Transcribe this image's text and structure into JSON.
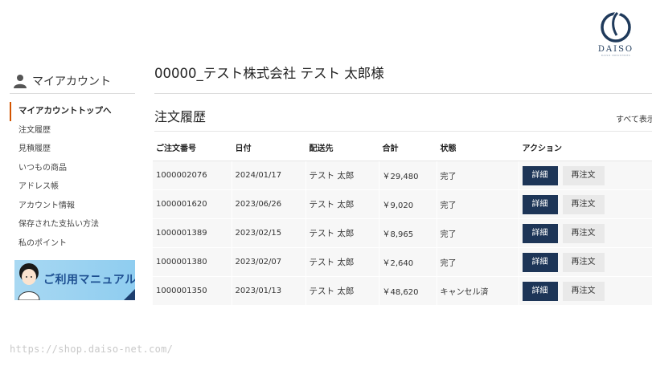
{
  "brand": {
    "name": "DAISO",
    "tagline": "DAISO INDUSTRIES",
    "color": "#1f3a5b"
  },
  "sidebar": {
    "title": "マイアカウント",
    "items": [
      {
        "label": "マイアカウントトップへ",
        "active": true
      },
      {
        "label": "注文履歴"
      },
      {
        "label": "見積履歴"
      },
      {
        "label": "いつもの商品"
      },
      {
        "label": "アドレス帳"
      },
      {
        "label": "アカウント情報"
      },
      {
        "label": "保存された支払い方法"
      },
      {
        "label": "私のポイント"
      }
    ],
    "banner_label": "ご利用マニュアル"
  },
  "main": {
    "title": "00000_テスト株式会社 テスト 太郎様",
    "section_title": "注文履歴",
    "view_all": "すべて表示"
  },
  "table": {
    "headers": [
      "ご注文番号",
      "日付",
      "配送先",
      "合計",
      "状態",
      "アクション"
    ],
    "rows": [
      {
        "order_no": "1000002076",
        "date": "2024/01/17",
        "ship_to": "テスト 太郎",
        "total": "￥29,480",
        "status": "完了",
        "detail": "詳細",
        "reorder": "再注文"
      },
      {
        "order_no": "1000001620",
        "date": "2023/06/26",
        "ship_to": "テスト 太郎",
        "total": "￥9,020",
        "status": "完了",
        "detail": "詳細",
        "reorder": "再注文"
      },
      {
        "order_no": "1000001389",
        "date": "2023/02/15",
        "ship_to": "テスト 太郎",
        "total": "￥8,965",
        "status": "完了",
        "detail": "詳細",
        "reorder": "再注文"
      },
      {
        "order_no": "1000001380",
        "date": "2023/02/07",
        "ship_to": "テスト 太郎",
        "total": "￥2,640",
        "status": "完了",
        "detail": "詳細",
        "reorder": "再注文"
      },
      {
        "order_no": "1000001350",
        "date": "2023/01/13",
        "ship_to": "テスト 太郎",
        "total": "￥48,620",
        "status": "キャンセル済",
        "detail": "詳細",
        "reorder": "再注文"
      }
    ]
  },
  "footer_url": "https://shop.daiso-net.com/",
  "colors": {
    "accent": "#d35400",
    "button_primary": "#1d3557",
    "button_secondary": "#e9e9e9"
  }
}
